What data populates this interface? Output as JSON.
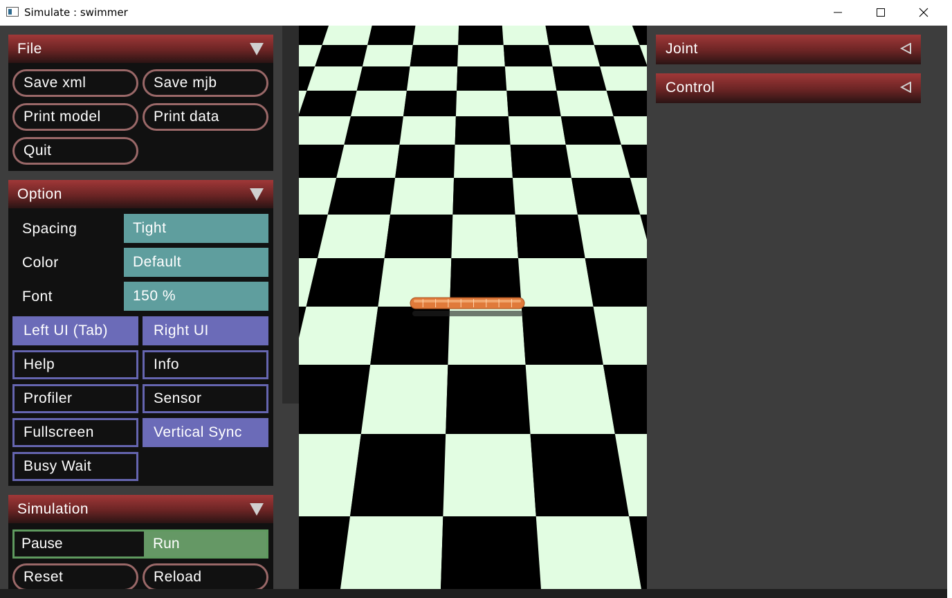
{
  "window": {
    "title": "Simulate : swimmer",
    "minimize_icon": "minimize-icon",
    "maximize_icon": "maximize-icon",
    "close_icon": "close-icon"
  },
  "left_ui": {
    "file": {
      "title": "File",
      "buttons": [
        "Save xml",
        "Save mjb",
        "Print model",
        "Print data",
        "Quit"
      ]
    },
    "option": {
      "title": "Option",
      "rows": [
        {
          "label": "Spacing",
          "value": "Tight"
        },
        {
          "label": "Color",
          "value": "Default"
        },
        {
          "label": "Font",
          "value": "150 %"
        }
      ],
      "toggles": [
        {
          "label": "Left UI (Tab)",
          "checked": true
        },
        {
          "label": "Right UI",
          "checked": true
        },
        {
          "label": "Help",
          "checked": false
        },
        {
          "label": "Info",
          "checked": false
        },
        {
          "label": "Profiler",
          "checked": false
        },
        {
          "label": "Sensor",
          "checked": false
        },
        {
          "label": "Fullscreen",
          "checked": false
        },
        {
          "label": "Vertical Sync",
          "checked": true
        },
        {
          "label": "Busy Wait",
          "checked": false
        }
      ]
    },
    "simulation": {
      "title": "Simulation",
      "run_state": {
        "pause": "Pause",
        "run": "Run",
        "selected": "Run"
      },
      "buttons": [
        "Reset",
        "Reload"
      ]
    }
  },
  "right_ui": {
    "sections": [
      {
        "title": "Joint",
        "collapsed": true
      },
      {
        "title": "Control",
        "collapsed": true
      }
    ]
  },
  "viewport": {
    "scene": "checkerboard floor with swimmer body",
    "colors": {
      "light_tile": "#e2fde2",
      "dark_tile": "#000000",
      "swimmer": "#e07a3a"
    }
  },
  "colors": {
    "section_header": "#8b2e2e",
    "round_button_border": "#9a6868",
    "check_on": "#6b6bb8",
    "check_border": "#6565b0",
    "select_value": "#5f9e9e",
    "run_green": "#659865",
    "panel_bg": "#3d3d3d"
  }
}
